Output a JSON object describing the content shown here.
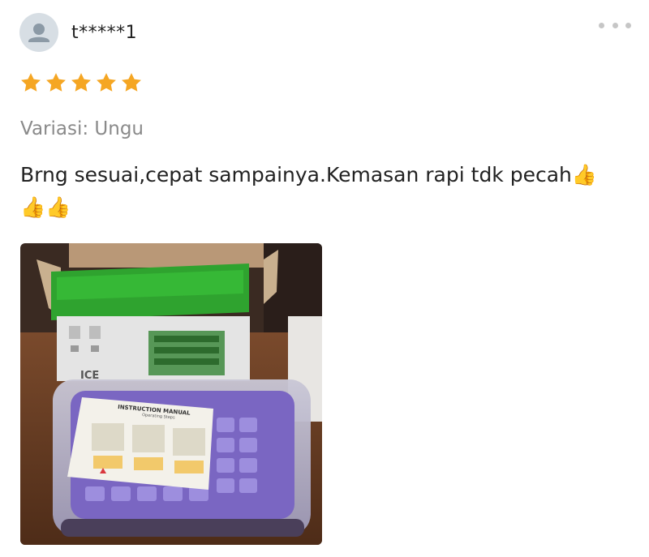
{
  "review": {
    "username": "t*****1",
    "rating": 5,
    "rating_max": 5,
    "variation": "Variasi: Ungu",
    "text": "Brng sesuai,cepat sampainya.Kemasan rapi tdk pecah👍👍👍"
  },
  "photo": {
    "manual_title": "INSTRUCTION MANUAL",
    "manual_subtitle": "Operating Steps",
    "box_label": "ICE"
  },
  "colors": {
    "star": "#f5a623",
    "avatar_bg": "#d7dee4",
    "avatar_fg": "#8c9aa6",
    "muted_text": "#8a8a8a"
  },
  "icons": {
    "avatar": "user-icon",
    "more": "more-horizontal-icon",
    "star": "star-icon"
  }
}
